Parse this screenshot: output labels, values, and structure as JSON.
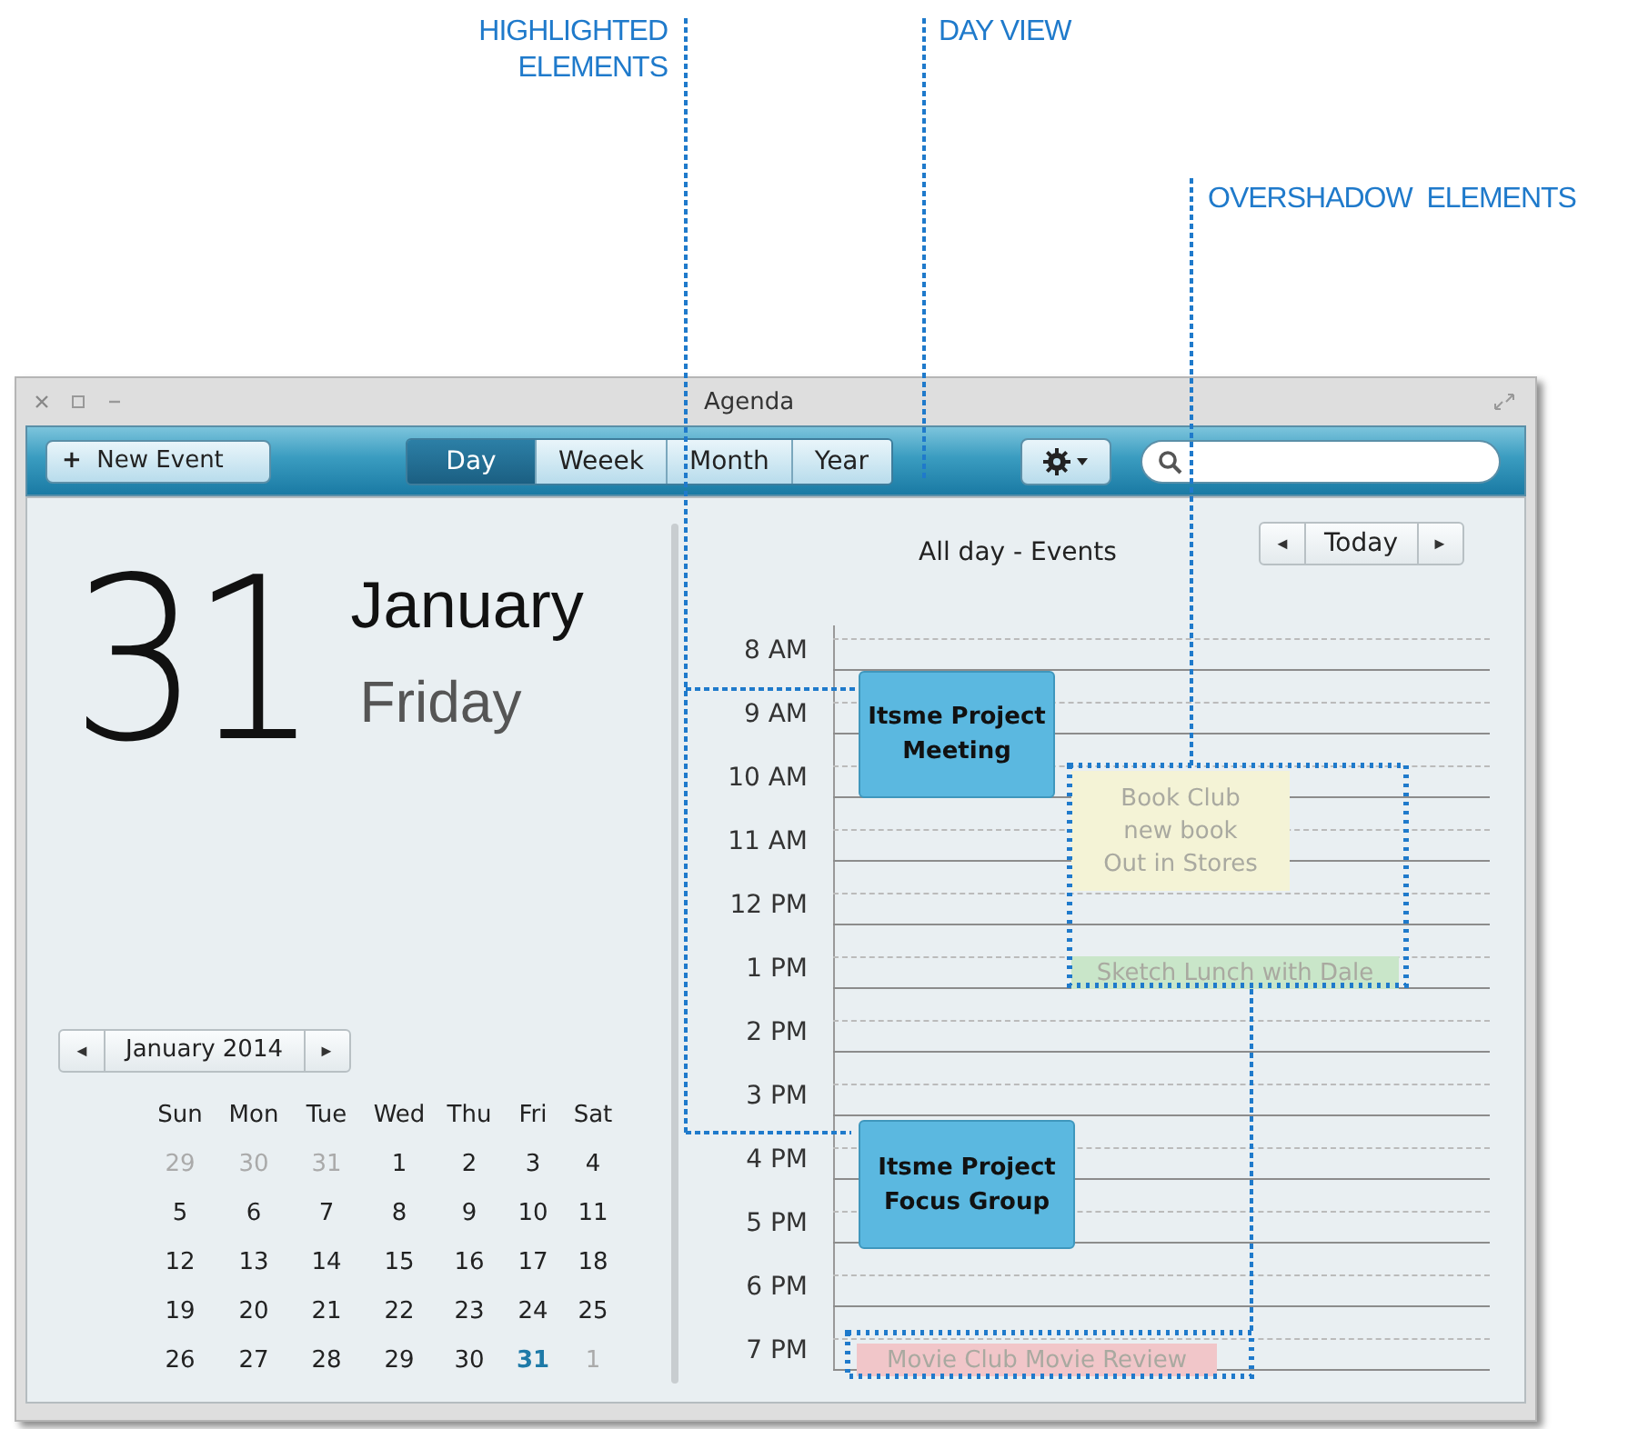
{
  "callouts": [
    {
      "label": "HIGHLIGHTED ELEMENTS",
      "kind": "highlighted"
    },
    {
      "label": "DAY VIEW",
      "kind": "dayview"
    },
    {
      "label": "OVERSHADOW  ELEMENTS",
      "kind": "overshadow"
    }
  ],
  "window": {
    "title": "Agenda"
  },
  "toolbar": {
    "new_button": "New Event",
    "new_icon": "+"
  },
  "tabs": [
    {
      "label": "Day",
      "selected": true
    },
    {
      "label": "Weeek",
      "selected": false
    },
    {
      "label": "Month",
      "selected": false
    },
    {
      "label": "Year",
      "selected": false
    }
  ],
  "date": {
    "day": "31",
    "month": "January",
    "weekday": "Friday"
  },
  "mini_calendar": {
    "title": "January 2014",
    "prev": "◄",
    "next": "►",
    "weekdays": [
      "Sun",
      "Mon",
      "Tue",
      "Wed",
      "Thu",
      "Fri",
      "Sat"
    ],
    "weeks": [
      [
        {
          "d": "29",
          "muted": true,
          "selected": false
        },
        {
          "d": "30",
          "muted": true,
          "selected": false
        },
        {
          "d": "31",
          "muted": true,
          "selected": false
        },
        {
          "d": "1",
          "muted": false,
          "selected": false
        },
        {
          "d": "2",
          "muted": false,
          "selected": false
        },
        {
          "d": "3",
          "muted": false,
          "selected": false
        },
        {
          "d": "4",
          "muted": false,
          "selected": false
        }
      ],
      [
        {
          "d": "5",
          "muted": false,
          "selected": false
        },
        {
          "d": "6",
          "muted": false,
          "selected": false
        },
        {
          "d": "7",
          "muted": false,
          "selected": false
        },
        {
          "d": "8",
          "muted": false,
          "selected": false
        },
        {
          "d": "9",
          "muted": false,
          "selected": false
        },
        {
          "d": "10",
          "muted": false,
          "selected": false
        },
        {
          "d": "11",
          "muted": false,
          "selected": false
        }
      ],
      [
        {
          "d": "12",
          "muted": false,
          "selected": false
        },
        {
          "d": "13",
          "muted": false,
          "selected": false
        },
        {
          "d": "14",
          "muted": false,
          "selected": false
        },
        {
          "d": "15",
          "muted": false,
          "selected": false
        },
        {
          "d": "16",
          "muted": false,
          "selected": false
        },
        {
          "d": "17",
          "muted": false,
          "selected": false
        },
        {
          "d": "18",
          "muted": false,
          "selected": false
        }
      ],
      [
        {
          "d": "19",
          "muted": false,
          "selected": false
        },
        {
          "d": "20",
          "muted": false,
          "selected": false
        },
        {
          "d": "21",
          "muted": false,
          "selected": false
        },
        {
          "d": "22",
          "muted": false,
          "selected": false
        },
        {
          "d": "23",
          "muted": false,
          "selected": false
        },
        {
          "d": "24",
          "muted": false,
          "selected": false
        },
        {
          "d": "25",
          "muted": false,
          "selected": false
        }
      ],
      [
        {
          "d": "26",
          "muted": false,
          "selected": false
        },
        {
          "d": "27",
          "muted": false,
          "selected": false
        },
        {
          "d": "28",
          "muted": false,
          "selected": false
        },
        {
          "d": "29",
          "muted": false,
          "selected": false
        },
        {
          "d": "30",
          "muted": false,
          "selected": false
        },
        {
          "d": "31",
          "muted": false,
          "selected": true
        },
        {
          "d": "1",
          "muted": true,
          "selected": false
        }
      ]
    ]
  },
  "day_view": {
    "header": "All day - Events",
    "prev": "◄",
    "today": "Today",
    "next": "►",
    "hours": [
      "8 AM",
      "9 AM",
      "10 AM",
      "11 AM",
      "12 PM",
      "1 PM",
      "2 PM",
      "3 PM",
      "4 PM",
      "5 PM",
      "6 PM",
      "7 PM"
    ],
    "events": [
      {
        "lines": [
          "Itsme Project",
          "Meeting"
        ],
        "color": "#5bb8e0",
        "faded": false
      },
      {
        "lines": [
          "Book Club",
          "new book",
          "Out in Stores"
        ],
        "color": "#f4f3d6",
        "faded": true
      },
      {
        "lines": [
          "Sketch Lunch with Dale"
        ],
        "color": "#c9e6c9",
        "faded": true
      },
      {
        "lines": [
          "Itsme Project",
          "Focus Group"
        ],
        "color": "#5bb8e0",
        "faded": false
      },
      {
        "lines": [
          "Movie Club Movie Review"
        ],
        "color": "#f1c6c9",
        "faded": true
      }
    ]
  }
}
